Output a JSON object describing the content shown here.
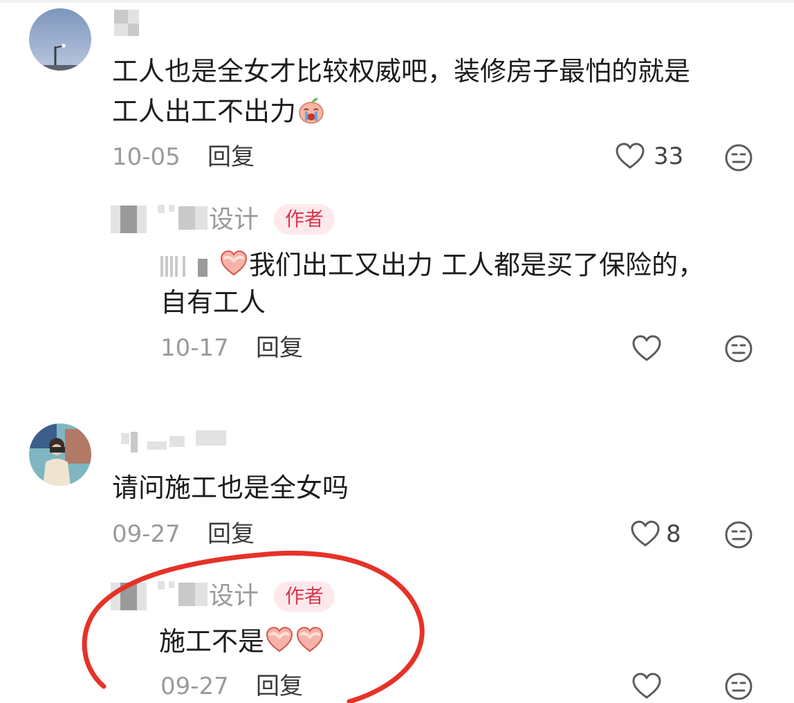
{
  "comments": [
    {
      "text_line1": "工人也是全女才比较权威吧，装修房子最怕的就是",
      "text_line2": "工人出工不出力",
      "date": "10-05",
      "reply_label": "回复",
      "likes": "33",
      "reply": {
        "name_suffix": "设计",
        "badge": "作者",
        "text_line1": "我们出工又出力 工人都是买了保险的，",
        "text_line2": "自有工人",
        "date": "10-17",
        "reply_label": "回复"
      }
    },
    {
      "text": "请问施工也是全女吗",
      "date": "09-27",
      "reply_label": "回复",
      "likes": "8",
      "reply": {
        "name_suffix": "设计",
        "badge": "作者",
        "text": "施工不是",
        "date": "09-27",
        "reply_label": "回复"
      }
    }
  ],
  "icons": {
    "like": "heart-outline-icon",
    "dislike": "meh-face-icon",
    "emoji_cry": "crying-peach-emoji",
    "emoji_heart": "heart-hands-emoji"
  },
  "colors": {
    "badge_bg": "#fde9ec",
    "badge_text": "#d9364d",
    "annotation": "#e63228"
  }
}
